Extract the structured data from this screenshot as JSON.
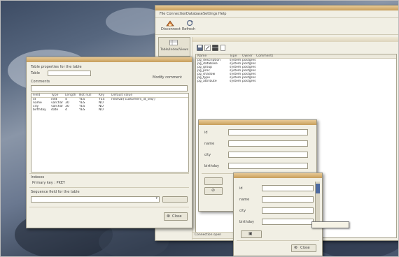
{
  "main_window": {
    "menu": [
      "File",
      "Connection",
      "Database",
      "Settings",
      "Help"
    ],
    "toolbar": [
      "Disconnect",
      "Refresh"
    ],
    "side_tab": "Table/Index/Views",
    "columns": [
      "Name",
      "Type",
      "Owner",
      "Comments"
    ],
    "rows": [
      [
        "pg_description",
        "system",
        "postgres",
        ""
      ],
      [
        "pg_database",
        "system",
        "postgres",
        ""
      ],
      [
        "pg_group",
        "system",
        "postgres",
        ""
      ],
      [
        "pg_proc",
        "system",
        "postgres",
        ""
      ],
      [
        "pg_shadow",
        "system",
        "postgres",
        ""
      ],
      [
        "pg_type",
        "system",
        "postgres",
        ""
      ],
      [
        "pg_attribute",
        "system",
        "postgres",
        ""
      ]
    ],
    "status": "Connection open"
  },
  "table_dialog": {
    "title": "Table properties for the table",
    "table_label": "Table",
    "table_value": "",
    "modify_button": "Modify comment",
    "comments_label": "Comments",
    "columns": [
      "Field",
      "Type",
      "Length",
      "Not null",
      "Key",
      "Default value"
    ],
    "rows": [
      [
        "id",
        "int4",
        "4",
        "YES",
        "YES",
        "nextval('customers_id_seq')"
      ],
      [
        "name",
        "varchar",
        "30",
        "YES",
        "NO",
        ""
      ],
      [
        "city",
        "varchar",
        "30",
        "YES",
        "NO",
        ""
      ],
      [
        "birthday",
        "date",
        "4",
        "YES",
        "NO",
        ""
      ]
    ],
    "indexes_label": "Indexes",
    "primary_key": "Primary key : PKEY",
    "sequence_label": "Sequence field for the table",
    "sequence_value": "",
    "close_button": "Close"
  },
  "record_dialog1": {
    "labels": [
      "id",
      "name",
      "city",
      "birthday"
    ],
    "values": [
      "",
      "",
      "",
      ""
    ]
  },
  "record_dialog2": {
    "labels": [
      "id",
      "name",
      "city",
      "birthday"
    ],
    "values": [
      "",
      "",
      "",
      ""
    ],
    "close_button": "Close"
  },
  "tooltip": {
    "text": ""
  },
  "colors": {
    "titlebar_accent": "#c79e5c",
    "window_bg": "#f1efe4",
    "desktop": "#57677f"
  }
}
